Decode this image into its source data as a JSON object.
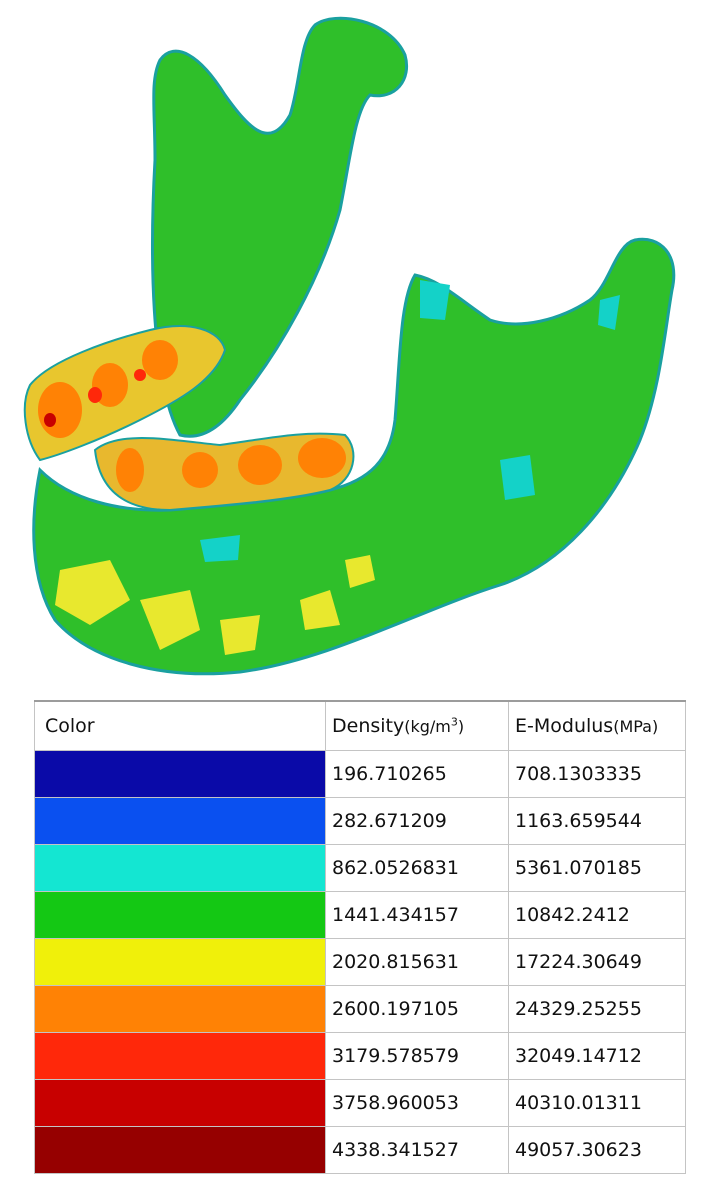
{
  "table": {
    "headers": {
      "color": "Color",
      "density": "Density",
      "density_unit_pre": "(kg/m",
      "density_unit_exp": "3",
      "density_unit_post": ")",
      "modulus": "E-Modulus",
      "modulus_unit": "(MPa)"
    },
    "rows": [
      {
        "color": "#0a0aa8",
        "density": "196.710265",
        "modulus": "708.1303335"
      },
      {
        "color": "#0a50f0",
        "density": "282.671209",
        "modulus": "1163.659544"
      },
      {
        "color": "#14e6d2",
        "density": "862.0526831",
        "modulus": "5361.070185"
      },
      {
        "color": "#14c814",
        "density": "1441.434157",
        "modulus": "10842.2412"
      },
      {
        "color": "#f0f00a",
        "density": "2020.815631",
        "modulus": "17224.30649"
      },
      {
        "color": "#ff8205",
        "density": "2600.197105",
        "modulus": "24329.25255"
      },
      {
        "color": "#ff280a",
        "density": "3179.578579",
        "modulus": "32049.14712"
      },
      {
        "color": "#c80000",
        "density": "3758.960053",
        "modulus": "40310.01311"
      },
      {
        "color": "#960000",
        "density": "4338.341527",
        "modulus": "49057.30623"
      }
    ]
  }
}
